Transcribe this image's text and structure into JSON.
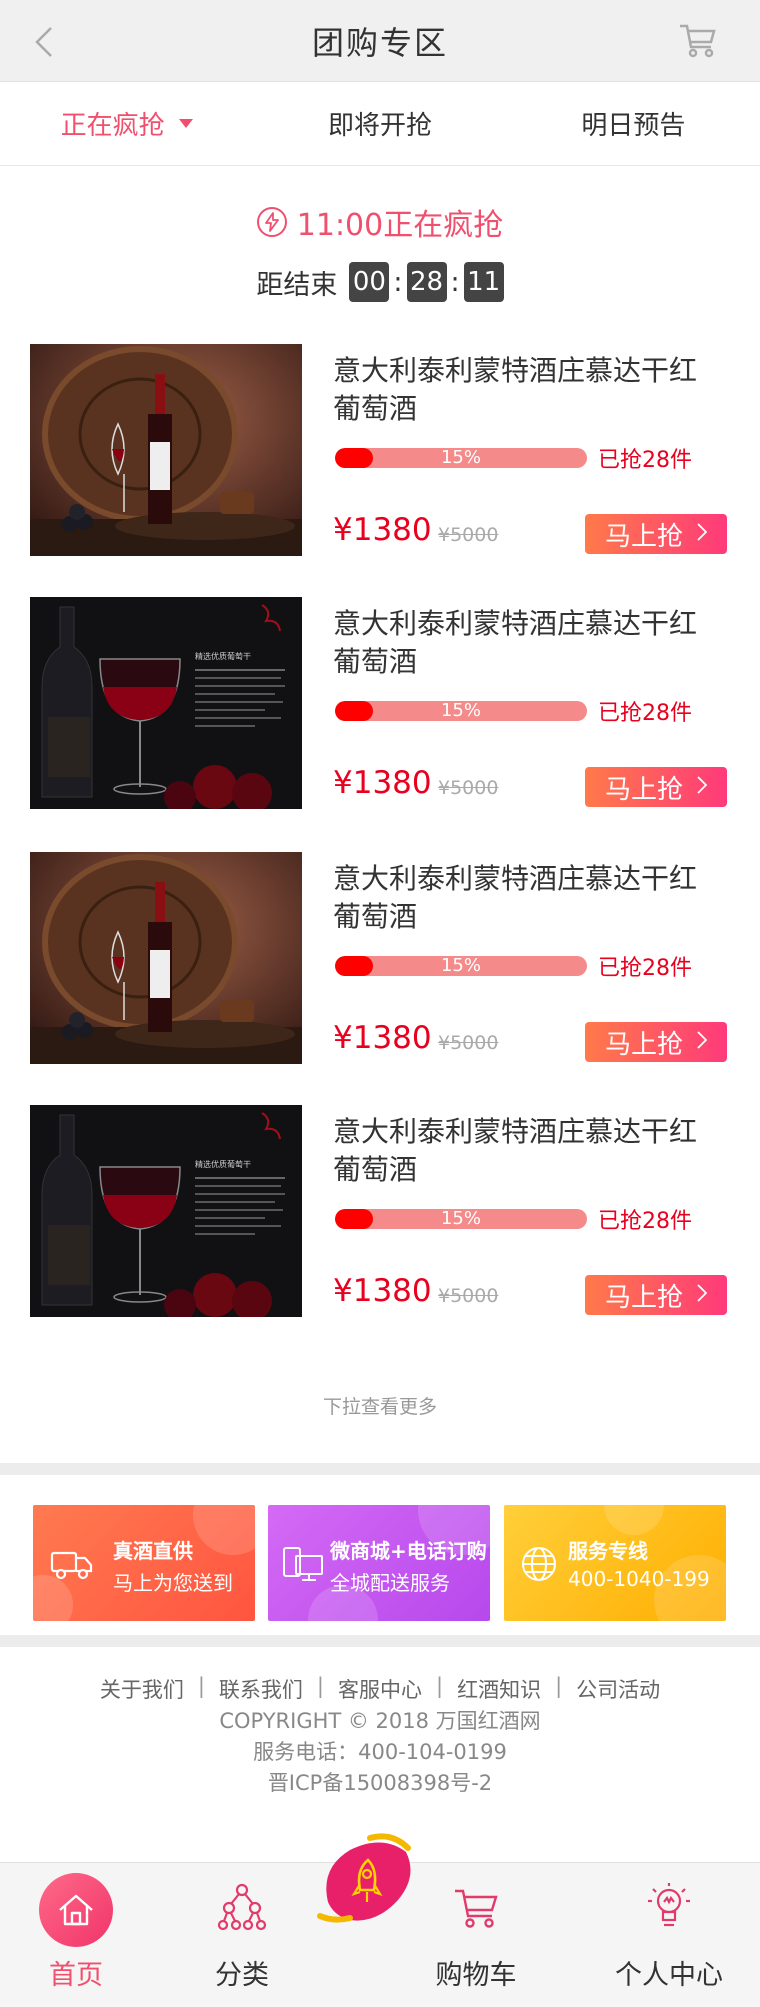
{
  "header": {
    "title": "团购专区",
    "back_icon": "chevron-left-icon",
    "cart_icon": "cart-icon"
  },
  "tabs": [
    {
      "label": "正在疯抢",
      "active": true
    },
    {
      "label": "即将开抢",
      "active": false
    },
    {
      "label": "明日预告",
      "active": false
    }
  ],
  "flash": {
    "title": "11:00正在疯抢",
    "icon": "lightning-icon"
  },
  "countdown": {
    "label": "距结束",
    "hours": "00",
    "minutes": "28",
    "seconds": "11"
  },
  "products": [
    {
      "name": "意大利泰利蒙特酒庄慕达干红葡萄酒",
      "progress_label": "15%",
      "progress": 0.15,
      "sold": "已抢28件",
      "price": "¥1380",
      "original": "¥5000",
      "buy": "马上抢",
      "image": "wine-barrel-photo"
    },
    {
      "name": "意大利泰利蒙特酒庄慕达干红葡萄酒",
      "progress_label": "15%",
      "progress": 0.15,
      "sold": "已抢28件",
      "price": "¥1380",
      "original": "¥5000",
      "buy": "马上抢",
      "image": "wine-roses-photo",
      "image_caption": "精选优质葡萄干"
    },
    {
      "name": "意大利泰利蒙特酒庄慕达干红葡萄酒",
      "progress_label": "15%",
      "progress": 0.15,
      "sold": "已抢28件",
      "price": "¥1380",
      "original": "¥5000",
      "buy": "马上抢",
      "image": "wine-barrel-photo"
    },
    {
      "name": "意大利泰利蒙特酒庄慕达干红葡萄酒",
      "progress_label": "15%",
      "progress": 0.15,
      "sold": "已抢28件",
      "price": "¥1380",
      "original": "¥5000",
      "buy": "马上抢",
      "image": "wine-roses-photo",
      "image_caption": "精选优质葡萄干"
    }
  ],
  "more": "下拉查看更多",
  "services": [
    {
      "title": "真酒直供",
      "subtitle": "马上为您送到",
      "icon": "truck-icon",
      "color": "#ff6a4a"
    },
    {
      "title": "微商城+电话订购",
      "subtitle": "全城配送服务",
      "icon": "phone-computer-icon",
      "color": "#c558f0"
    },
    {
      "title": "服务专线",
      "subtitle": "400-1040-199",
      "icon": "globe-icon",
      "color": "#ffbc1a"
    }
  ],
  "footer": {
    "links": [
      "关于我们",
      "联系我们",
      "客服中心",
      "红酒知识",
      "公司活动"
    ],
    "copyright": "COPYRIGHT © 2018 万国红酒网",
    "phone": "服务电话：400-104-0199",
    "icp": "晋ICP备15008398号-2"
  },
  "bottom_nav": [
    {
      "label": "首页",
      "icon": "home-icon",
      "active": true
    },
    {
      "label": "分类",
      "icon": "category-tree-icon",
      "active": false
    },
    {
      "label": "购物车",
      "icon": "cart-icon",
      "active": false
    },
    {
      "label": "个人中心",
      "icon": "lightbulb-user-icon",
      "active": false
    }
  ],
  "float_icon": "rocket-icon",
  "colors": {
    "accent": "#f0506e",
    "price": "#e8001f",
    "bar_fill": "#ff0000",
    "bar_track": "#f58a8a"
  }
}
